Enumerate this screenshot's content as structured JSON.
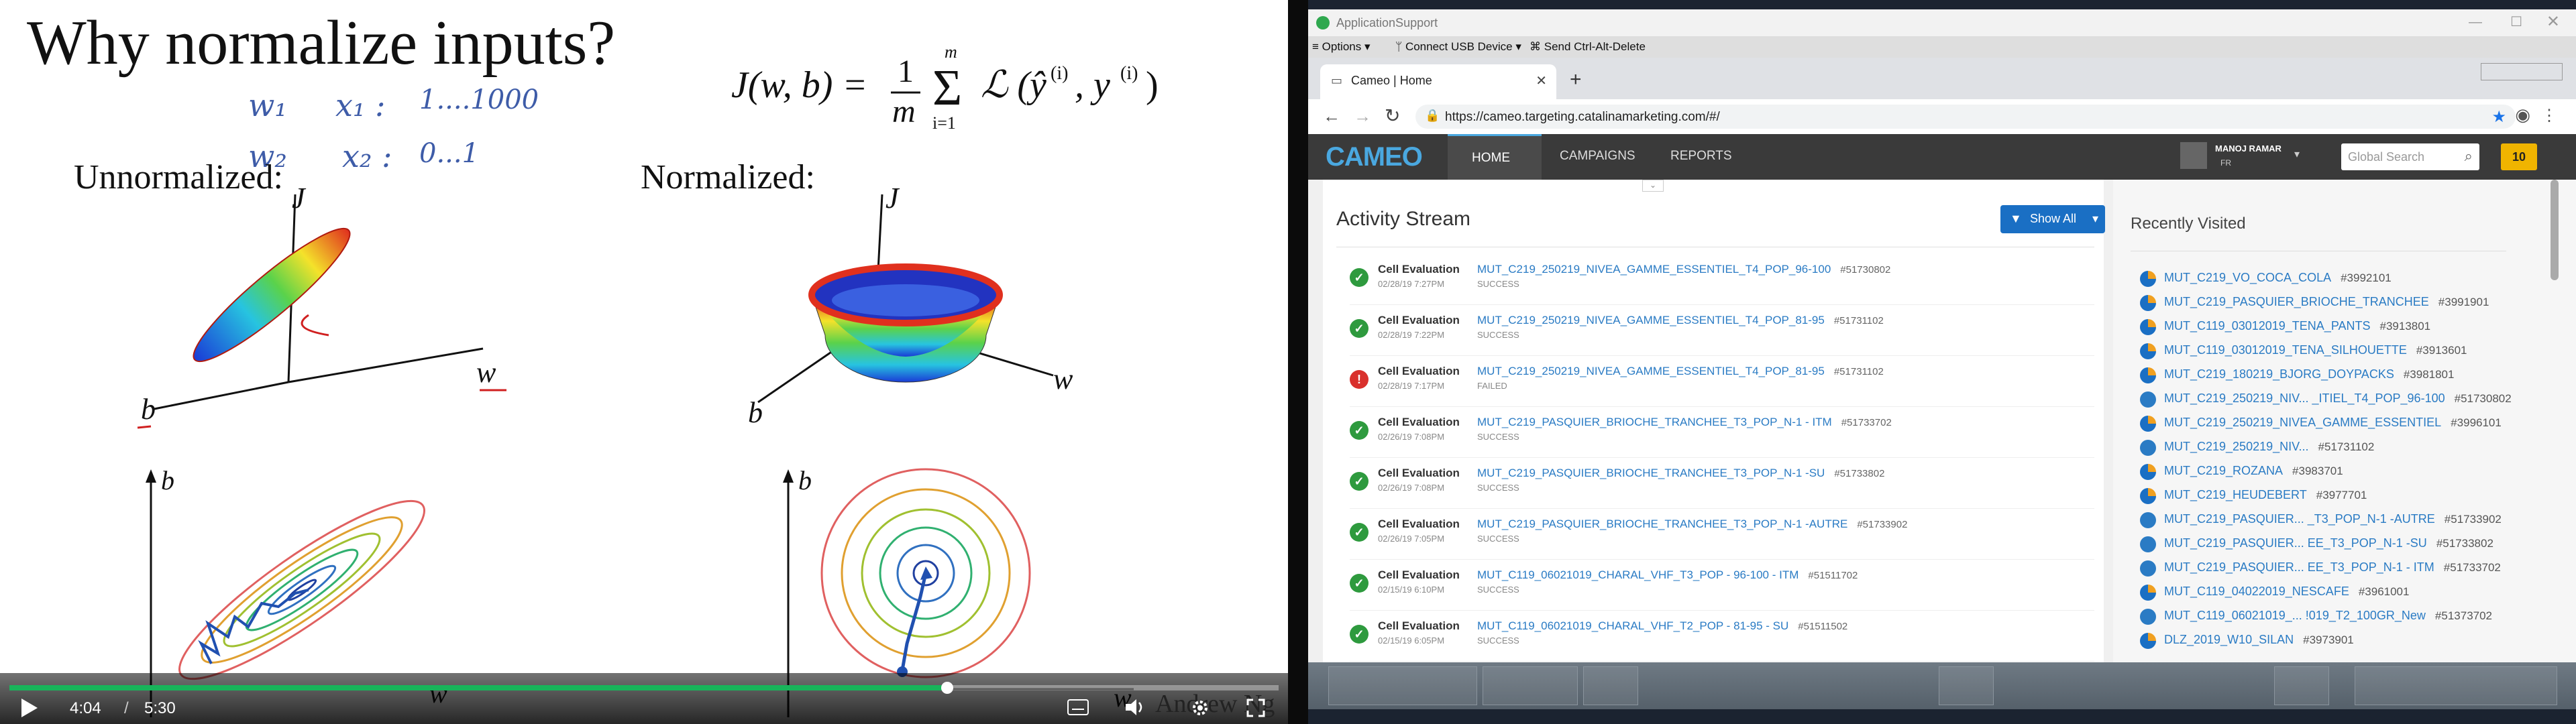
{
  "slide": {
    "title": "Why normalize inputs?",
    "unnormalized_label": "Unnormalized:",
    "normalized_label": "Normalized:",
    "handwriting": {
      "w1": "w₁",
      "x1": "x₁ :",
      "x1_range": "1....1000",
      "w2": "w₂",
      "x2": "x₂ :",
      "x2_range": "0...1"
    },
    "axis_j": "J",
    "axis_w": "w",
    "axis_b": "b",
    "watermark": "Andrew Ng"
  },
  "video": {
    "current_time": "4:04",
    "separator": "/",
    "duration": "5:30",
    "progress_fraction": 0.739
  },
  "vm": {
    "title": "ApplicationSupport",
    "menu": {
      "options": "Options",
      "connect_usb": "Connect USB Device",
      "ctrl_alt_del": "Send Ctrl-Alt-Delete"
    }
  },
  "browser": {
    "tab_title": "Cameo | Home",
    "url": "https://cameo.targeting.catalinamarketing.com/#/"
  },
  "app": {
    "logo": "CAMEO",
    "nav": [
      "HOME",
      "CAMPAIGNS",
      "REPORTS"
    ],
    "user_name": "MANOJ RAMAR",
    "user_locale": "FR",
    "search_placeholder": "Global Search",
    "notification_count": "10"
  },
  "activity": {
    "title": "Activity Stream",
    "show_all": "Show All",
    "items": [
      {
        "type": "Cell Evaluation",
        "name": "MUT_C219_250219_NIVEA_GAMME_ESSENTIEL_T4_POP_96-100",
        "id": "#51730802",
        "date": "02/28/19 7:27PM",
        "status": "SUCCESS",
        "ok": true
      },
      {
        "type": "Cell Evaluation",
        "name": "MUT_C219_250219_NIVEA_GAMME_ESSENTIEL_T4_POP_81-95",
        "id": "#51731102",
        "date": "02/28/19 7:22PM",
        "status": "SUCCESS",
        "ok": true
      },
      {
        "type": "Cell Evaluation",
        "name": "MUT_C219_250219_NIVEA_GAMME_ESSENTIEL_T4_POP_81-95",
        "id": "#51731102",
        "date": "02/28/19 7:17PM",
        "status": "FAILED",
        "ok": false
      },
      {
        "type": "Cell Evaluation",
        "name": "MUT_C219_PASQUIER_BRIOCHE_TRANCHEE_T3_POP_N-1 - ITM",
        "id": "#51733702",
        "date": "02/26/19 7:08PM",
        "status": "SUCCESS",
        "ok": true
      },
      {
        "type": "Cell Evaluation",
        "name": "MUT_C219_PASQUIER_BRIOCHE_TRANCHEE_T3_POP_N-1 -SU",
        "id": "#51733802",
        "date": "02/26/19 7:08PM",
        "status": "SUCCESS",
        "ok": true
      },
      {
        "type": "Cell Evaluation",
        "name": "MUT_C219_PASQUIER_BRIOCHE_TRANCHEE_T3_POP_N-1 -AUTRE",
        "id": "#51733902",
        "date": "02/26/19 7:05PM",
        "status": "SUCCESS",
        "ok": true
      },
      {
        "type": "Cell Evaluation",
        "name": "MUT_C119_06021019_CHARAL_VHF_T3_POP - 96-100 - ITM",
        "id": "#51511702",
        "date": "02/15/19 6:10PM",
        "status": "SUCCESS",
        "ok": true
      },
      {
        "type": "Cell Evaluation",
        "name": "MUT_C119_06021019_CHARAL_VHF_T2_POP - 81-95 - SU",
        "id": "#51511502",
        "date": "02/15/19 6:05PM",
        "status": "SUCCESS",
        "ok": true
      }
    ]
  },
  "recent": {
    "title": "Recently Visited",
    "items": [
      {
        "name": "MUT_C219_VO_COCA_COLA",
        "id": "#3992101",
        "icon": "pie"
      },
      {
        "name": "MUT_C219_PASQUIER_BRIOCHE_TRANCHEE",
        "id": "#3991901",
        "icon": "pie"
      },
      {
        "name": "MUT_C119_03012019_TENA_PANTS",
        "id": "#3913801",
        "icon": "pie"
      },
      {
        "name": "MUT_C119_03012019_TENA_SILHOUETTE",
        "id": "#3913601",
        "icon": "pie"
      },
      {
        "name": "MUT_C219_180219_BJORG_DOYPACKS",
        "id": "#3981801",
        "icon": "pie"
      },
      {
        "name": "MUT_C219_250219_NIV... _ITIEL_T4_POP_96-100",
        "id": "#51730802",
        "icon": "cell"
      },
      {
        "name": "MUT_C219_250219_NIVEA_GAMME_ESSENTIEL",
        "id": "#3996101",
        "icon": "pie"
      },
      {
        "name": "MUT_C219_250219_NIV...",
        "id": "#51731102",
        "icon": "cell"
      },
      {
        "name": "MUT_C219_ROZANA",
        "id": "#3983701",
        "icon": "pie"
      },
      {
        "name": "MUT_C219_HEUDEBERT",
        "id": "#3977701",
        "icon": "pie"
      },
      {
        "name": "MUT_C219_PASQUIER... _T3_POP_N-1 -AUTRE",
        "id": "#51733902",
        "icon": "cell"
      },
      {
        "name": "MUT_C219_PASQUIER... EE_T3_POP_N-1 -SU",
        "id": "#51733802",
        "icon": "cell"
      },
      {
        "name": "MUT_C219_PASQUIER... EE_T3_POP_N-1 - ITM",
        "id": "#51733702",
        "icon": "cell"
      },
      {
        "name": "MUT_C119_04022019_NESCAFE",
        "id": "#3961001",
        "icon": "pie"
      },
      {
        "name": "MUT_C119_06021019_... !019_T2_100GR_New",
        "id": "#51373702",
        "icon": "cell"
      },
      {
        "name": "DLZ_2019_W10_SILAN",
        "id": "#3973901",
        "icon": "pie"
      }
    ]
  },
  "colors": {
    "accent": "#1a6fc4",
    "success": "#2e9a3e",
    "failed": "#d9302c",
    "progress": "#18b45a",
    "notification": "#f0b400"
  }
}
